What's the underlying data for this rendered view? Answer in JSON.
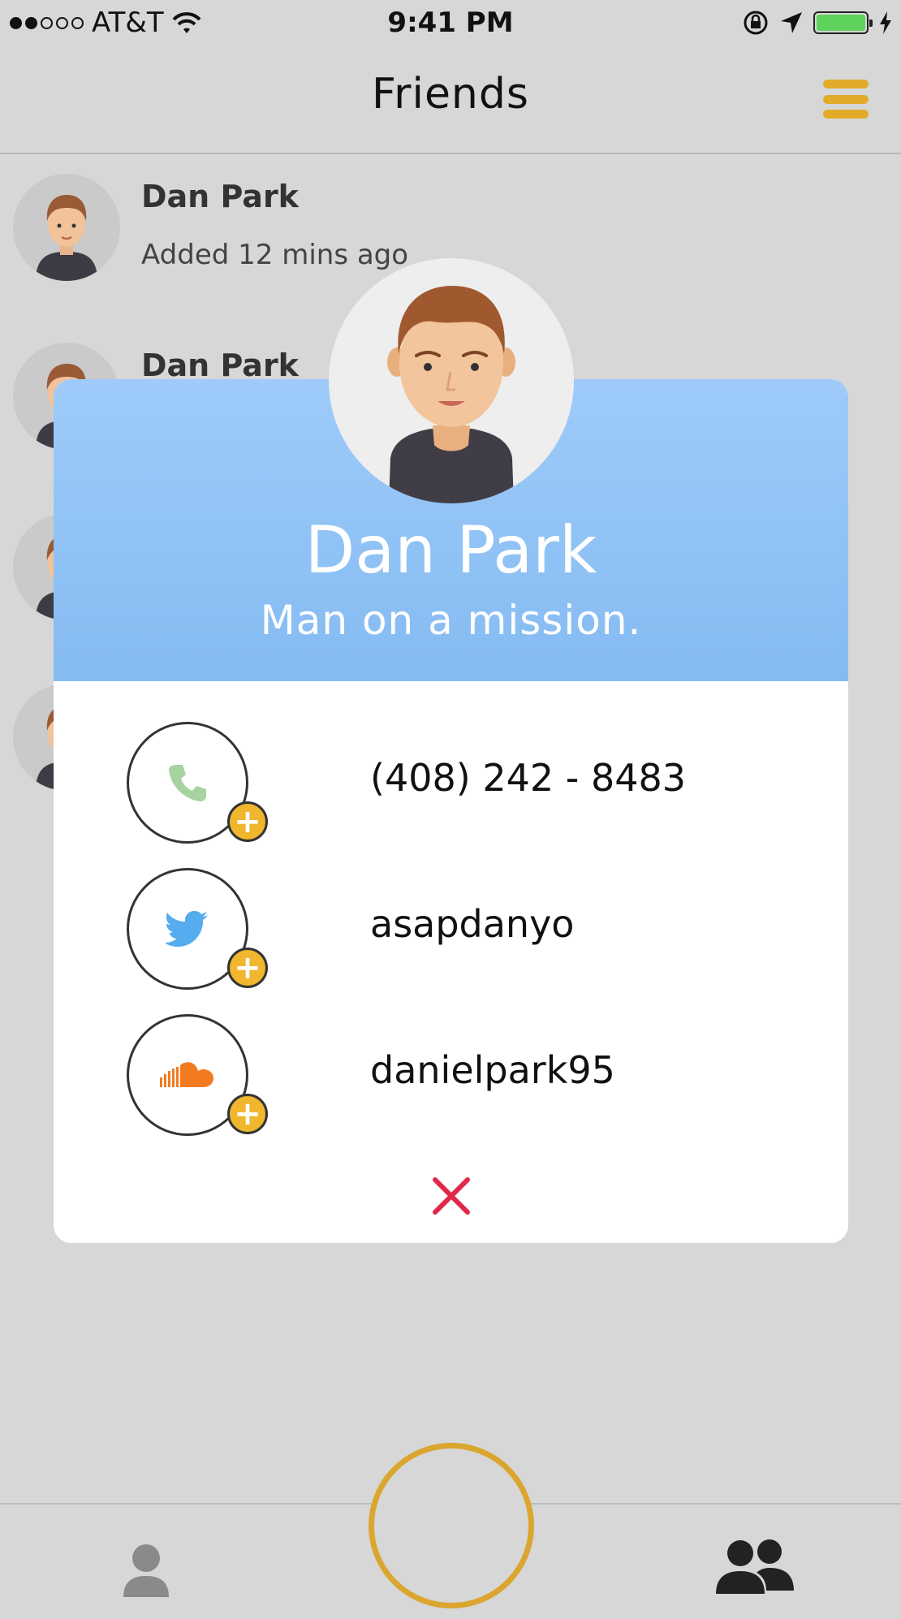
{
  "status_bar": {
    "carrier": "AT&T",
    "time": "9:41 PM",
    "signal_bars_filled": 2,
    "signal_bars_total": 5,
    "battery_level": 1.0,
    "icons": [
      "wifi-icon",
      "rotation-lock-icon",
      "location-arrow-icon",
      "battery-icon",
      "charging-bolt-icon"
    ]
  },
  "nav": {
    "title": "Friends",
    "menu_icon": "hamburger-menu-icon"
  },
  "friends": [
    {
      "name": "Dan Park",
      "subtitle": "Added 12 mins ago"
    },
    {
      "name": "Dan Park",
      "subtitle": ""
    }
  ],
  "profile_card": {
    "name": "Dan Park",
    "status": "Man on a mission.",
    "contacts": [
      {
        "icon": "phone-icon",
        "value": "(408) 242 - 8483"
      },
      {
        "icon": "twitter-icon",
        "value": "asapdanyo"
      },
      {
        "icon": "soundcloud-icon",
        "value": "danielpark95"
      }
    ],
    "close_icon": "close-icon"
  },
  "tab_bar": {
    "items": [
      "profile-icon",
      "record-button",
      "friends-icon"
    ]
  },
  "colors": {
    "accent": "#e2ab2a",
    "header_blue": "#8cc0f5",
    "close_red": "#e0294a",
    "phone_green": "#a6d3a0",
    "twitter_blue": "#55acee",
    "soundcloud_orange": "#f27b1f",
    "background": "#d7d7d7"
  }
}
